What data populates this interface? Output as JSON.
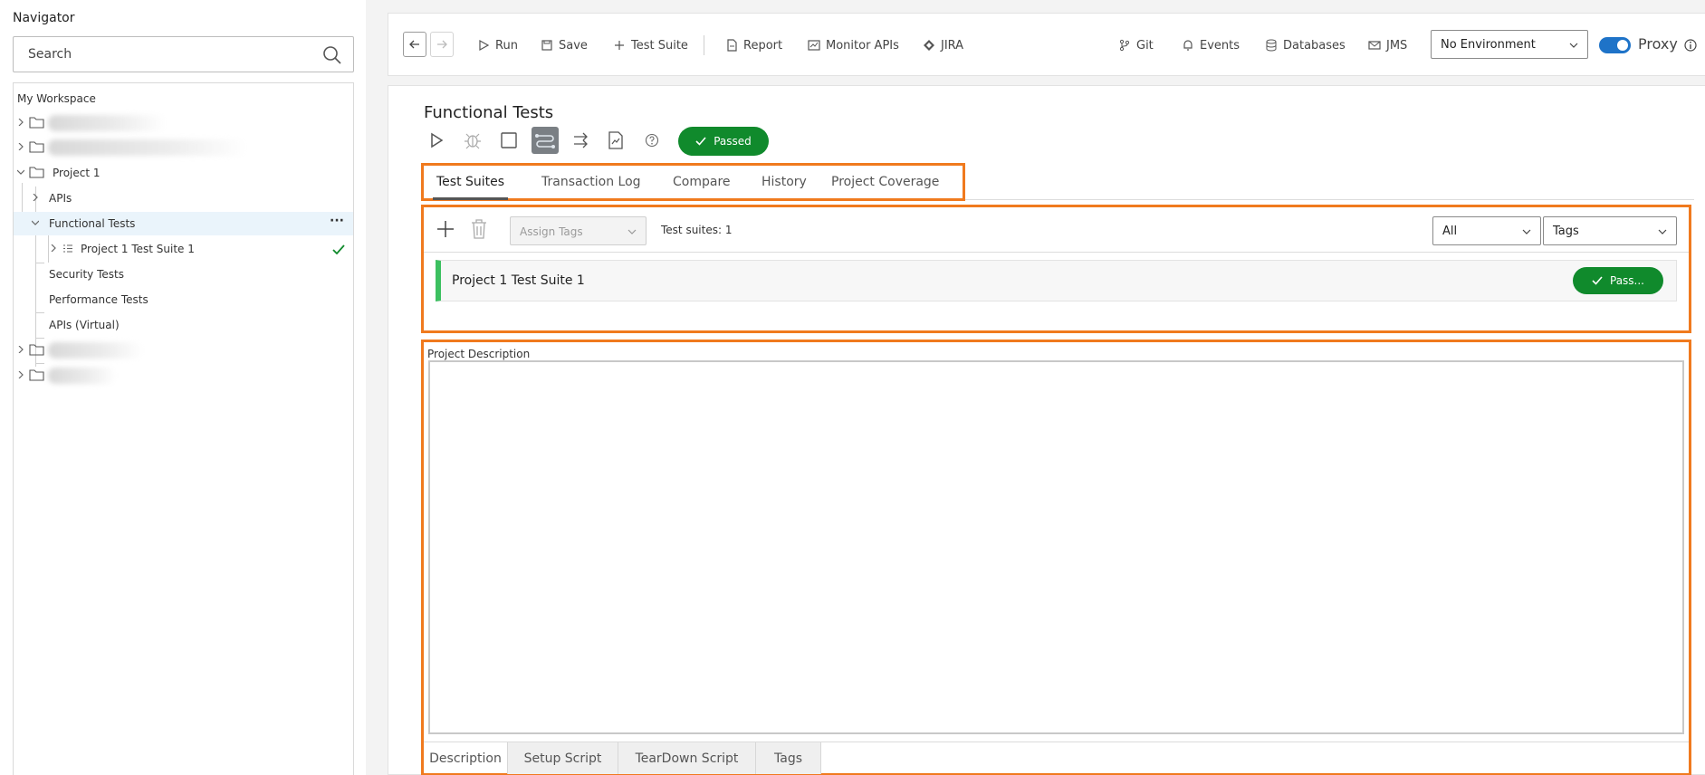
{
  "navigator": {
    "title": "Navigator",
    "search_placeholder": "Search",
    "workspace": "My Workspace",
    "items": {
      "project1": "Project 1",
      "apis": "APIs",
      "functional_tests": "Functional Tests",
      "suite1": "Project 1 Test Suite 1",
      "security_tests": "Security Tests",
      "performance_tests": "Performance Tests",
      "apis_virtual": "APIs (Virtual)"
    },
    "more_label": "···"
  },
  "toolbar": {
    "run": "Run",
    "save": "Save",
    "test_suite": "Test Suite",
    "report": "Report",
    "monitor_apis": "Monitor APIs",
    "jira": "JIRA",
    "git": "Git",
    "events": "Events",
    "databases": "Databases",
    "jms": "JMS",
    "environment": "No Environment",
    "proxy": "Proxy",
    "proxy_enabled": true
  },
  "main": {
    "title": "Functional Tests",
    "status": "Passed",
    "tabs": [
      "Test Suites",
      "Transaction Log",
      "Compare",
      "History",
      "Project Coverage"
    ],
    "suites": {
      "assign_tags": "Assign Tags",
      "count_label": "Test suites: 1",
      "filter_all": "All",
      "filter_tags": "Tags",
      "rows": [
        {
          "name": "Project 1 Test Suite 1",
          "status": "Pass..."
        }
      ]
    },
    "description": {
      "label": "Project Description",
      "value": "",
      "tabs": [
        "Description",
        "Setup Script",
        "TearDown Script",
        "Tags"
      ]
    }
  },
  "colors": {
    "highlight": "#f07a1e",
    "pass": "#108a2c",
    "accent": "#1e73c8",
    "suite_bar": "#3cc060"
  }
}
